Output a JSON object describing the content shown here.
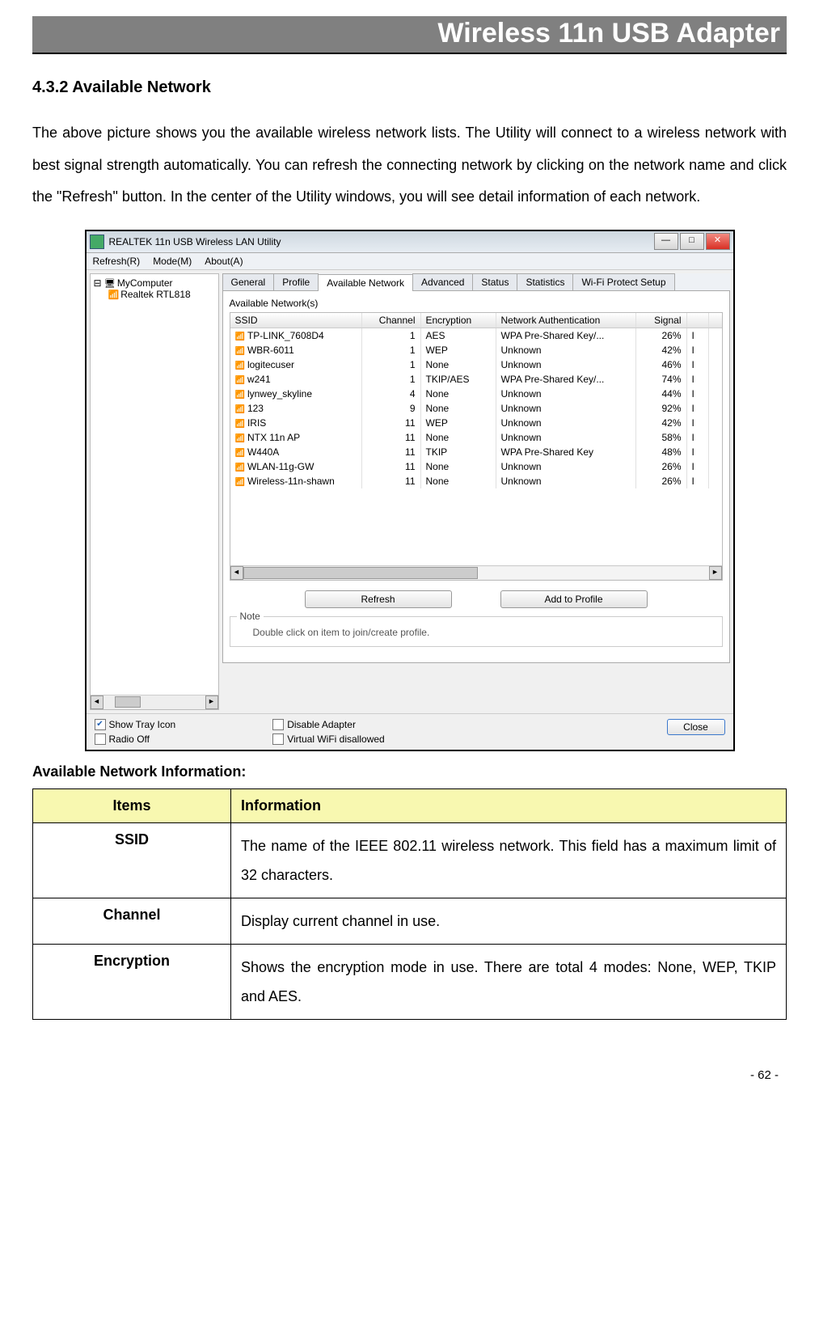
{
  "header_title": "Wireless 11n USB Adapter",
  "section_heading": "4.3.2    Available Network",
  "body_paragraph": "The above picture shows you the available wireless network lists. The Utility will connect to a wireless network with best signal strength automatically. You can refresh the connecting network by clicking on the network name and click the \"Refresh\" button. In the center of the Utility windows, you will see detail information of each network.",
  "window": {
    "title": "REALTEK 11n USB Wireless LAN Utility",
    "menubar": [
      "Refresh(R)",
      "Mode(M)",
      "About(A)"
    ],
    "tree": {
      "root": "MyComputer",
      "child": "Realtek RTL818"
    },
    "tabs": [
      "General",
      "Profile",
      "Available Network",
      "Advanced",
      "Status",
      "Statistics",
      "Wi-Fi Protect Setup"
    ],
    "active_tab": "Available Network",
    "group_label": "Available Network(s)",
    "columns": [
      "SSID",
      "Channel",
      "Encryption",
      "Network Authentication",
      "Signal"
    ],
    "rows": [
      {
        "ssid": "TP-LINK_7608D4",
        "channel": "1",
        "enc": "AES",
        "auth": "WPA Pre-Shared Key/...",
        "signal": "26%",
        "extra": "I"
      },
      {
        "ssid": "WBR-6011",
        "channel": "1",
        "enc": "WEP",
        "auth": "Unknown",
        "signal": "42%",
        "extra": "I"
      },
      {
        "ssid": "logitecuser",
        "channel": "1",
        "enc": "None",
        "auth": "Unknown",
        "signal": "46%",
        "extra": "I"
      },
      {
        "ssid": "w241",
        "channel": "1",
        "enc": "TKIP/AES",
        "auth": "WPA Pre-Shared Key/...",
        "signal": "74%",
        "extra": "I"
      },
      {
        "ssid": "lynwey_skyline",
        "channel": "4",
        "enc": "None",
        "auth": "Unknown",
        "signal": "44%",
        "extra": "I"
      },
      {
        "ssid": "123",
        "channel": "9",
        "enc": "None",
        "auth": "Unknown",
        "signal": "92%",
        "extra": "I"
      },
      {
        "ssid": "IRIS",
        "channel": "11",
        "enc": "WEP",
        "auth": "Unknown",
        "signal": "42%",
        "extra": "I"
      },
      {
        "ssid": "NTX 11n AP",
        "channel": "11",
        "enc": "None",
        "auth": "Unknown",
        "signal": "58%",
        "extra": "I"
      },
      {
        "ssid": "W440A",
        "channel": "11",
        "enc": "TKIP",
        "auth": "WPA Pre-Shared Key",
        "signal": "48%",
        "extra": "I"
      },
      {
        "ssid": "WLAN-11g-GW",
        "channel": "11",
        "enc": "None",
        "auth": "Unknown",
        "signal": "26%",
        "extra": "I"
      },
      {
        "ssid": "Wireless-11n-shawn",
        "channel": "11",
        "enc": "None",
        "auth": "Unknown",
        "signal": "26%",
        "extra": "I"
      }
    ],
    "buttons": {
      "refresh": "Refresh",
      "add": "Add to Profile"
    },
    "note_label": "Note",
    "note_text": "Double click on item to join/create profile.",
    "checkboxes": {
      "show_tray": "Show Tray Icon",
      "radio_off": "Radio Off",
      "disable_adapter": "Disable Adapter",
      "virtual_wifi": "Virtual WiFi disallowed"
    },
    "close": "Close"
  },
  "doc_subheading": "Available Network Information:",
  "info_header": {
    "items": "Items",
    "information": "Information"
  },
  "info_rows": [
    {
      "item": "SSID",
      "desc": "The name of the IEEE 802.11 wireless network. This field has a maximum limit of 32 characters."
    },
    {
      "item": "Channel",
      "desc": "Display current channel in use."
    },
    {
      "item": "Encryption",
      "desc": "Shows the encryption mode in use. There are total 4 modes: None, WEP, TKIP and AES."
    }
  ],
  "page_number": "- 62 -"
}
